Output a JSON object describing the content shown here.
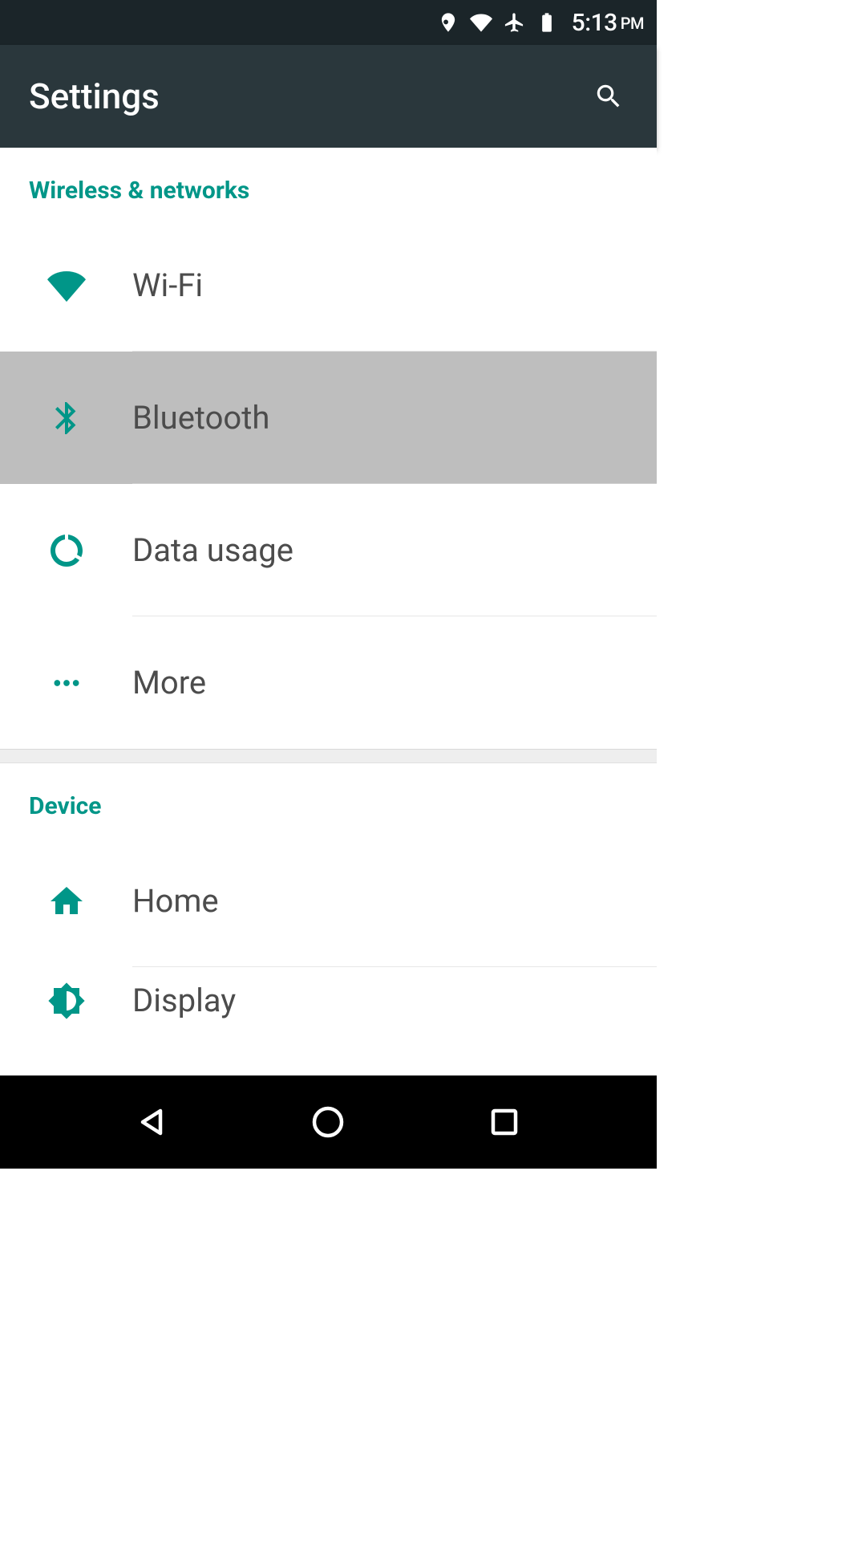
{
  "statusbar": {
    "time": "5:13",
    "ampm": "PM"
  },
  "appbar": {
    "title": "Settings"
  },
  "sections": {
    "wireless": {
      "header": "Wireless & networks",
      "wifi": "Wi‑Fi",
      "bluetooth": "Bluetooth",
      "data_usage": "Data usage",
      "more": "More"
    },
    "device": {
      "header": "Device",
      "home": "Home",
      "display": "Display"
    }
  },
  "colors": {
    "accent": "#009688",
    "statusbar": "#1b2529",
    "appbar": "#2a373c",
    "highlight": "#bebebe"
  }
}
